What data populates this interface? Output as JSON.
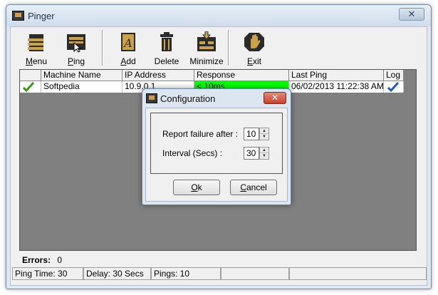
{
  "window": {
    "title": "Pinger",
    "close_glyph": "✕"
  },
  "toolbar": {
    "menu": {
      "label_u": "M",
      "label_rest": "enu",
      "icon": "menu-icon"
    },
    "ping": {
      "label_u": "P",
      "label_rest": "ing",
      "icon": "ping-icon"
    },
    "add": {
      "label_u": "A",
      "label_rest": "dd",
      "icon": "add-icon"
    },
    "delete": {
      "label": "Delete",
      "icon": "trash-icon"
    },
    "minimize": {
      "label": "Minimize",
      "icon": "minimize-icon"
    },
    "exit": {
      "label_u": "E",
      "label_rest": "xit",
      "icon": "hand-icon"
    }
  },
  "table": {
    "columns": [
      "",
      "Machine Name",
      "IP Address",
      "Response",
      "Last Ping",
      "Log"
    ],
    "rows": [
      {
        "status_icon": "check-icon",
        "machine": "Softpedia",
        "ip": "10.9.0.1",
        "response": "< 10ms",
        "last_ping": "06/02/2013 11:22:38 AM",
        "log_icon": "check-blue-icon"
      }
    ],
    "response_color": "#00ff00"
  },
  "dialog": {
    "title": "Configuration",
    "close_glyph": "✕",
    "report_label": "Report failure after :",
    "report_value": "10",
    "interval_label": "Interval (Secs) :",
    "interval_value": "30",
    "ok_u": "O",
    "ok_rest": "k",
    "cancel_u": "C",
    "cancel_rest": "ancel"
  },
  "errors": {
    "label": "Errors:",
    "value": "0"
  },
  "status_bar": {
    "ping_time": "Ping Time: 30",
    "delay": "Delay: 30 Secs",
    "pings": "Pings: 10",
    "cell4": "",
    "cell5": ""
  }
}
